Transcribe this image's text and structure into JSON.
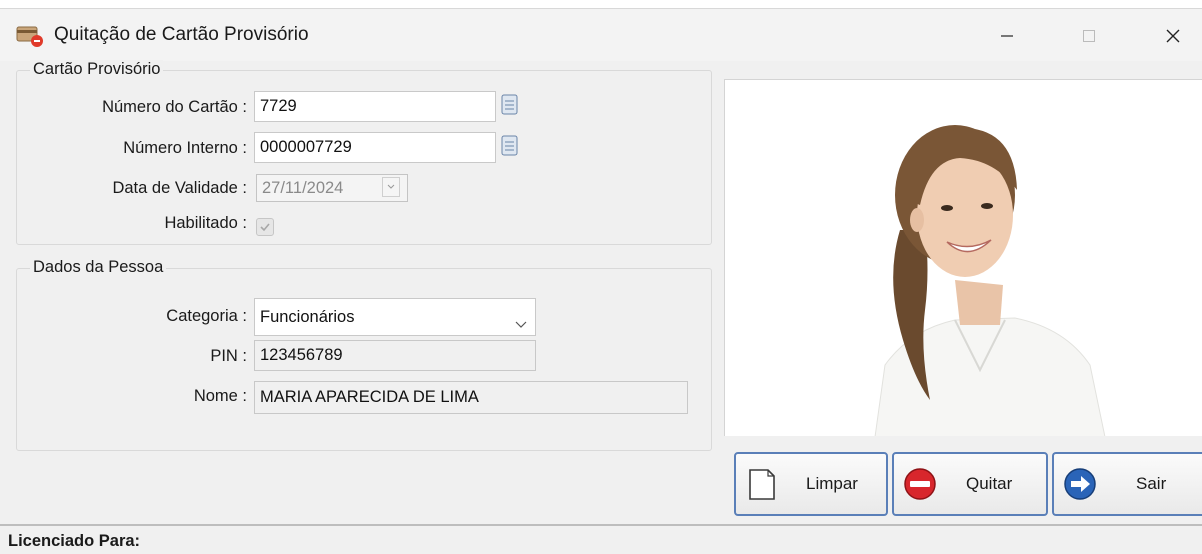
{
  "window": {
    "title": "Quitação de Cartão Provisório"
  },
  "cartao": {
    "group_title": "Cartão Provisório",
    "numero_label": "Número do Cartão :",
    "numero_value": "7729",
    "interno_label": "Número Interno :",
    "interno_value": "0000007729",
    "validade_label": "Data de Validade :",
    "validade_value": "27/11/2024",
    "habilitado_label": "Habilitado :",
    "habilitado_checked": true
  },
  "pessoa": {
    "group_title": "Dados da Pessoa",
    "categoria_label": "Categoria :",
    "categoria_value": "Funcionários",
    "pin_label": "PIN :",
    "pin_value": "123456789",
    "nome_label": "Nome :",
    "nome_value": "MARIA APARECIDA DE LIMA"
  },
  "buttons": {
    "limpar": "Limpar",
    "quitar": "Quitar",
    "sair": "Sair"
  },
  "status": {
    "licenciado_label": "Licenciado Para:"
  },
  "icons": {
    "app": "card-payment-icon",
    "lookup": "lookup-icon",
    "limpar": "blank-page-icon",
    "quitar": "no-entry-icon",
    "sair": "exit-arrow-icon"
  },
  "colors": {
    "button_border": "#5a7fb8",
    "quitar_red": "#d8262c",
    "sair_blue": "#2a64b8"
  }
}
